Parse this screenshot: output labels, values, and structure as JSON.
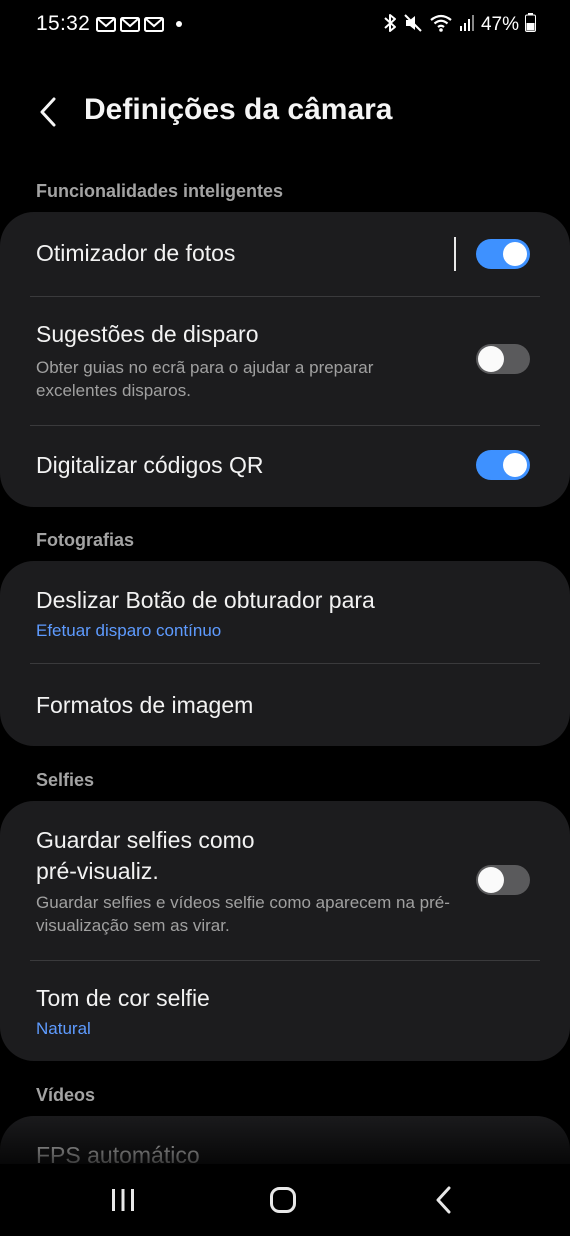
{
  "status_bar": {
    "time": "15:32",
    "battery_percent": "47%",
    "icons": [
      "email-notification-icon",
      "email-notification-icon",
      "email-notification-icon",
      "more-notifications-dot",
      "bluetooth-icon",
      "mute-icon",
      "wifi-icon",
      "signal-icon",
      "battery-icon"
    ]
  },
  "header": {
    "title": "Definições da câmara",
    "back_icon": "chevron-left-icon"
  },
  "sections": {
    "smart": {
      "label": "Funcionalidades inteligentes",
      "items": [
        {
          "title": "Otimizador de fotos",
          "toggle": true
        },
        {
          "title": "Sugestões de disparo",
          "subtitle": "Obter guias no ecrã para o ajudar a preparar excelentes disparos.",
          "toggle": false
        },
        {
          "title": "Digitalizar códigos QR",
          "toggle": true
        }
      ]
    },
    "photos": {
      "label": "Fotografias",
      "items": [
        {
          "title": "Deslizar Botão de obturador para",
          "value": "Efetuar disparo contínuo"
        },
        {
          "title": "Formatos de imagem"
        }
      ]
    },
    "selfies": {
      "label": "Selfies",
      "items": [
        {
          "title_line1": "Guardar selfies como",
          "title_line2": "pré-visualiz.",
          "subtitle": "Guardar selfies e vídeos selfie como aparecem na pré-visualização sem as virar.",
          "toggle": false
        },
        {
          "title": "Tom de cor selfie",
          "value": "Natural"
        }
      ]
    },
    "videos": {
      "label": "Vídeos",
      "items": [
        {
          "title": "FPS automático"
        }
      ]
    }
  },
  "nav_bar": {
    "recents_icon": "recents-icon",
    "home_icon": "home-icon",
    "back_icon": "back-icon"
  },
  "colors": {
    "background": "#000000",
    "card": "#1c1c1e",
    "accent": "#3e91ff",
    "link_text": "#5e9bff",
    "secondary_text": "#a0a0a0"
  }
}
